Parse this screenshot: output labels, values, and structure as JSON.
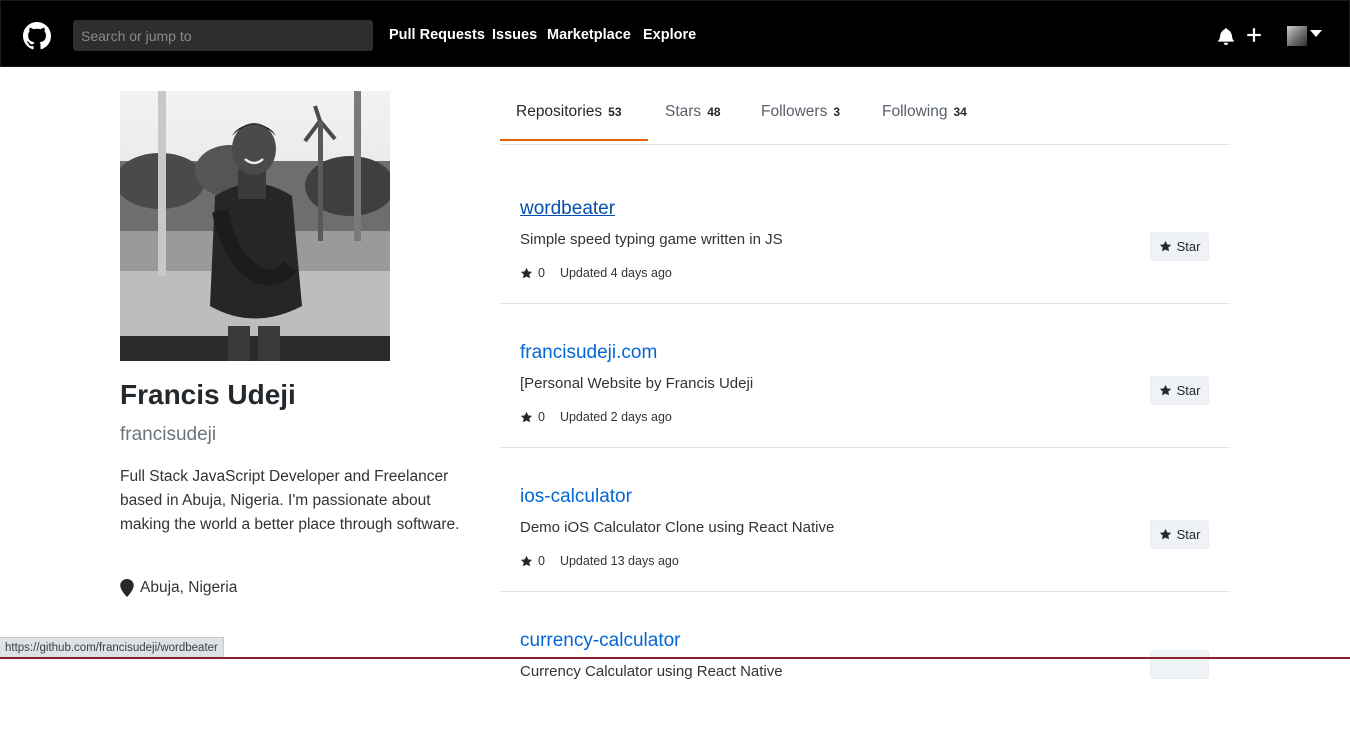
{
  "header": {
    "search_placeholder": "Search or jump to",
    "nav": [
      "Pull Requests",
      "Issues",
      "Marketplace",
      "Explore"
    ],
    "icons": [
      "github-logo",
      "bell-icon",
      "plus-icon",
      "avatar",
      "caret-down-icon"
    ]
  },
  "profile": {
    "name": "Francis Udeji",
    "username": "francisudeji",
    "bio": "Full Stack JavaScript Developer and Freelancer based in Abuja, Nigeria. I'm passionate about making the world a better place through software.",
    "location": "Abuja, Nigeria"
  },
  "tabs": [
    {
      "label": "Repositories",
      "count": "53"
    },
    {
      "label": "Stars",
      "count": "48"
    },
    {
      "label": "Followers",
      "count": "3"
    },
    {
      "label": "Following",
      "count": "34"
    }
  ],
  "repos": [
    {
      "name": "wordbeater",
      "description": "Simple speed typing game written in JS",
      "stars": "0",
      "updated": "Updated 4 days ago",
      "star_label": "Star"
    },
    {
      "name": "francisudeji.com",
      "description": "[Personal Website by Francis Udeji",
      "stars": "0",
      "updated": "Updated 2 days ago",
      "star_label": "Star"
    },
    {
      "name": "ios-calculator",
      "description": "Demo iOS Calculator Clone using React Native",
      "stars": "0",
      "updated": "Updated 13 days ago",
      "star_label": "Star"
    },
    {
      "name": "currency-calculator",
      "description": "Currency Calculator using React Native",
      "stars": "",
      "updated": "",
      "star_label": ""
    }
  ],
  "status_url": "https://github.com/francisudeji/wordbeater",
  "colors": {
    "header_bg": "#000000",
    "link": "#0366d6",
    "active_tab": "#e36209",
    "border": "#e1e4e8"
  }
}
